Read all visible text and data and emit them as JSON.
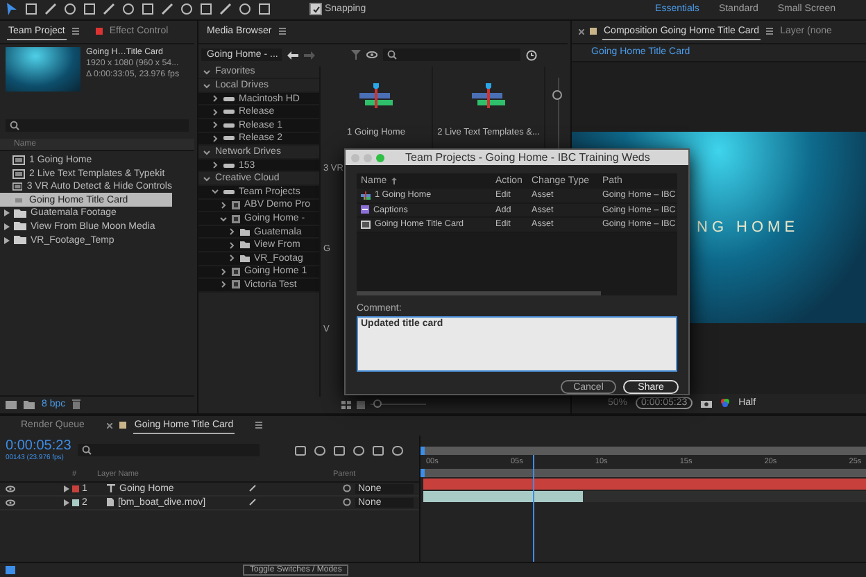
{
  "toolbar": {
    "snapping": {
      "label": "Snapping",
      "checked": true
    },
    "workspaces": [
      {
        "label": "Essentials",
        "selected": true
      },
      {
        "label": "Standard",
        "selected": false
      },
      {
        "label": "Small Screen",
        "selected": false
      }
    ]
  },
  "project_panel": {
    "tabs": [
      {
        "label": "Team Project",
        "selected": true
      },
      {
        "label": "Effect Control",
        "selected": false
      }
    ],
    "info": {
      "name": "Going H…Title Card",
      "size": "1920 x 1080  (960 x 54...",
      "duration": "Δ 0:00:33:05, 23.976 fps"
    },
    "column": "Name",
    "items": [
      {
        "name": "1 Going Home",
        "kind": "comp",
        "selected": false
      },
      {
        "name": "2 Live Text Templates & Typekit",
        "kind": "comp",
        "selected": false
      },
      {
        "name": "3 VR Auto Detect & Hide Controls",
        "kind": "comp",
        "selected": false
      },
      {
        "name": "Going Home Title Card",
        "kind": "comp",
        "selected": true
      },
      {
        "name": "Guatemala Footage",
        "kind": "folder",
        "selected": false
      },
      {
        "name": "View From Blue Moon Media",
        "kind": "folder",
        "selected": false
      },
      {
        "name": "VR_Footage_Temp",
        "kind": "folder",
        "selected": false
      }
    ],
    "bit_depth": "8 bpc"
  },
  "media_browser": {
    "title": "Media Browser",
    "location": "Going Home - ...",
    "tree": [
      {
        "label": "Favorites",
        "kind": "section",
        "expanded": true
      },
      {
        "label": "Local Drives",
        "kind": "section",
        "expanded": true,
        "children": [
          {
            "label": "Macintosh HD",
            "kind": "drive",
            "expanded": false
          },
          {
            "label": "Release",
            "kind": "drive",
            "expanded": false
          },
          {
            "label": "Release 1",
            "kind": "drive",
            "expanded": false
          },
          {
            "label": "Release 2",
            "kind": "drive",
            "expanded": false
          }
        ]
      },
      {
        "label": "Network Drives",
        "kind": "section",
        "expanded": true,
        "children": [
          {
            "label": "153",
            "kind": "drive",
            "expanded": false
          }
        ]
      },
      {
        "label": "Creative Cloud",
        "kind": "section",
        "expanded": true,
        "children": [
          {
            "label": "Team Projects",
            "kind": "drive",
            "expanded": true,
            "children": [
              {
                "label": "ABV Demo Pro",
                "kind": "project",
                "expanded": false
              },
              {
                "label": "Going Home -",
                "kind": "project",
                "expanded": true,
                "children": [
                  {
                    "label": "Guatemala",
                    "kind": "folder",
                    "expanded": false
                  },
                  {
                    "label": "View From",
                    "kind": "folder",
                    "expanded": false
                  },
                  {
                    "label": "VR_Footag",
                    "kind": "folder",
                    "expanded": false
                  }
                ]
              },
              {
                "label": "Going Home 1",
                "kind": "project",
                "expanded": false
              },
              {
                "label": "Victoria Test",
                "kind": "project",
                "expanded": false
              }
            ]
          }
        ]
      }
    ],
    "tiles": [
      {
        "label": "1 Going Home"
      },
      {
        "label": "2 Live Text Templates &..."
      }
    ],
    "covered_labels": [
      "3 VR",
      "G",
      "V"
    ],
    "zoom_slider": {
      "level": 0.95
    },
    "thumbnail_slider": {
      "level": 0.05
    }
  },
  "composition_panel": {
    "tabs": [
      {
        "label": "Composition Going Home Title Card",
        "selected": true
      },
      {
        "label": "Layer (none",
        "selected": false
      }
    ],
    "breadcrumb": "Going Home Title Card",
    "title_text": "NG HOME",
    "zoom": "50%",
    "timecode": "0:00:05:23",
    "resolution": "Half"
  },
  "dialog": {
    "title": "Team Projects - Going Home - IBC Training Weds",
    "columns": [
      "Name",
      "Action",
      "Change Type",
      "Path"
    ],
    "rows": [
      {
        "kind": "comp",
        "name": "1 Going Home",
        "action": "Edit",
        "change_type": "Asset",
        "path": "Going Home – IBC"
      },
      {
        "kind": "captions",
        "name": "Captions",
        "action": "Add",
        "change_type": "Asset",
        "path": "Going Home – IBC"
      },
      {
        "kind": "footage",
        "name": "Going Home Title Card",
        "action": "Edit",
        "change_type": "Asset",
        "path": "Going Home – IBC"
      }
    ],
    "comment_label": "Comment:",
    "comment": "Updated title card",
    "buttons": [
      {
        "label": "Cancel",
        "selected": false
      },
      {
        "label": "Share",
        "selected": true
      }
    ]
  },
  "timeline": {
    "tabs": [
      {
        "label": "Render Queue",
        "selected": false
      },
      {
        "label": "Going Home Title Card",
        "selected": true
      }
    ],
    "timecode": "0:00:05:23",
    "frame_info": "00143 (23.976 fps)",
    "columns": {
      "number": "#",
      "layer_name": "Layer Name",
      "parent": "Parent"
    },
    "layers": [
      {
        "number": "1",
        "kind": "text",
        "name": "Going Home",
        "color": "#c8403c",
        "parent": "None",
        "level": 1
      },
      {
        "number": "2",
        "kind": "footage",
        "name": "[bm_boat_dive.mov]",
        "color": "#a9cbc6",
        "parent": "None",
        "level": 0.36
      }
    ],
    "ruler": [
      "00s",
      "05s",
      "10s",
      "15s",
      "20s",
      "25s"
    ],
    "playhead": {
      "level": 0.24
    },
    "toggle": "Toggle Switches / Modes"
  }
}
